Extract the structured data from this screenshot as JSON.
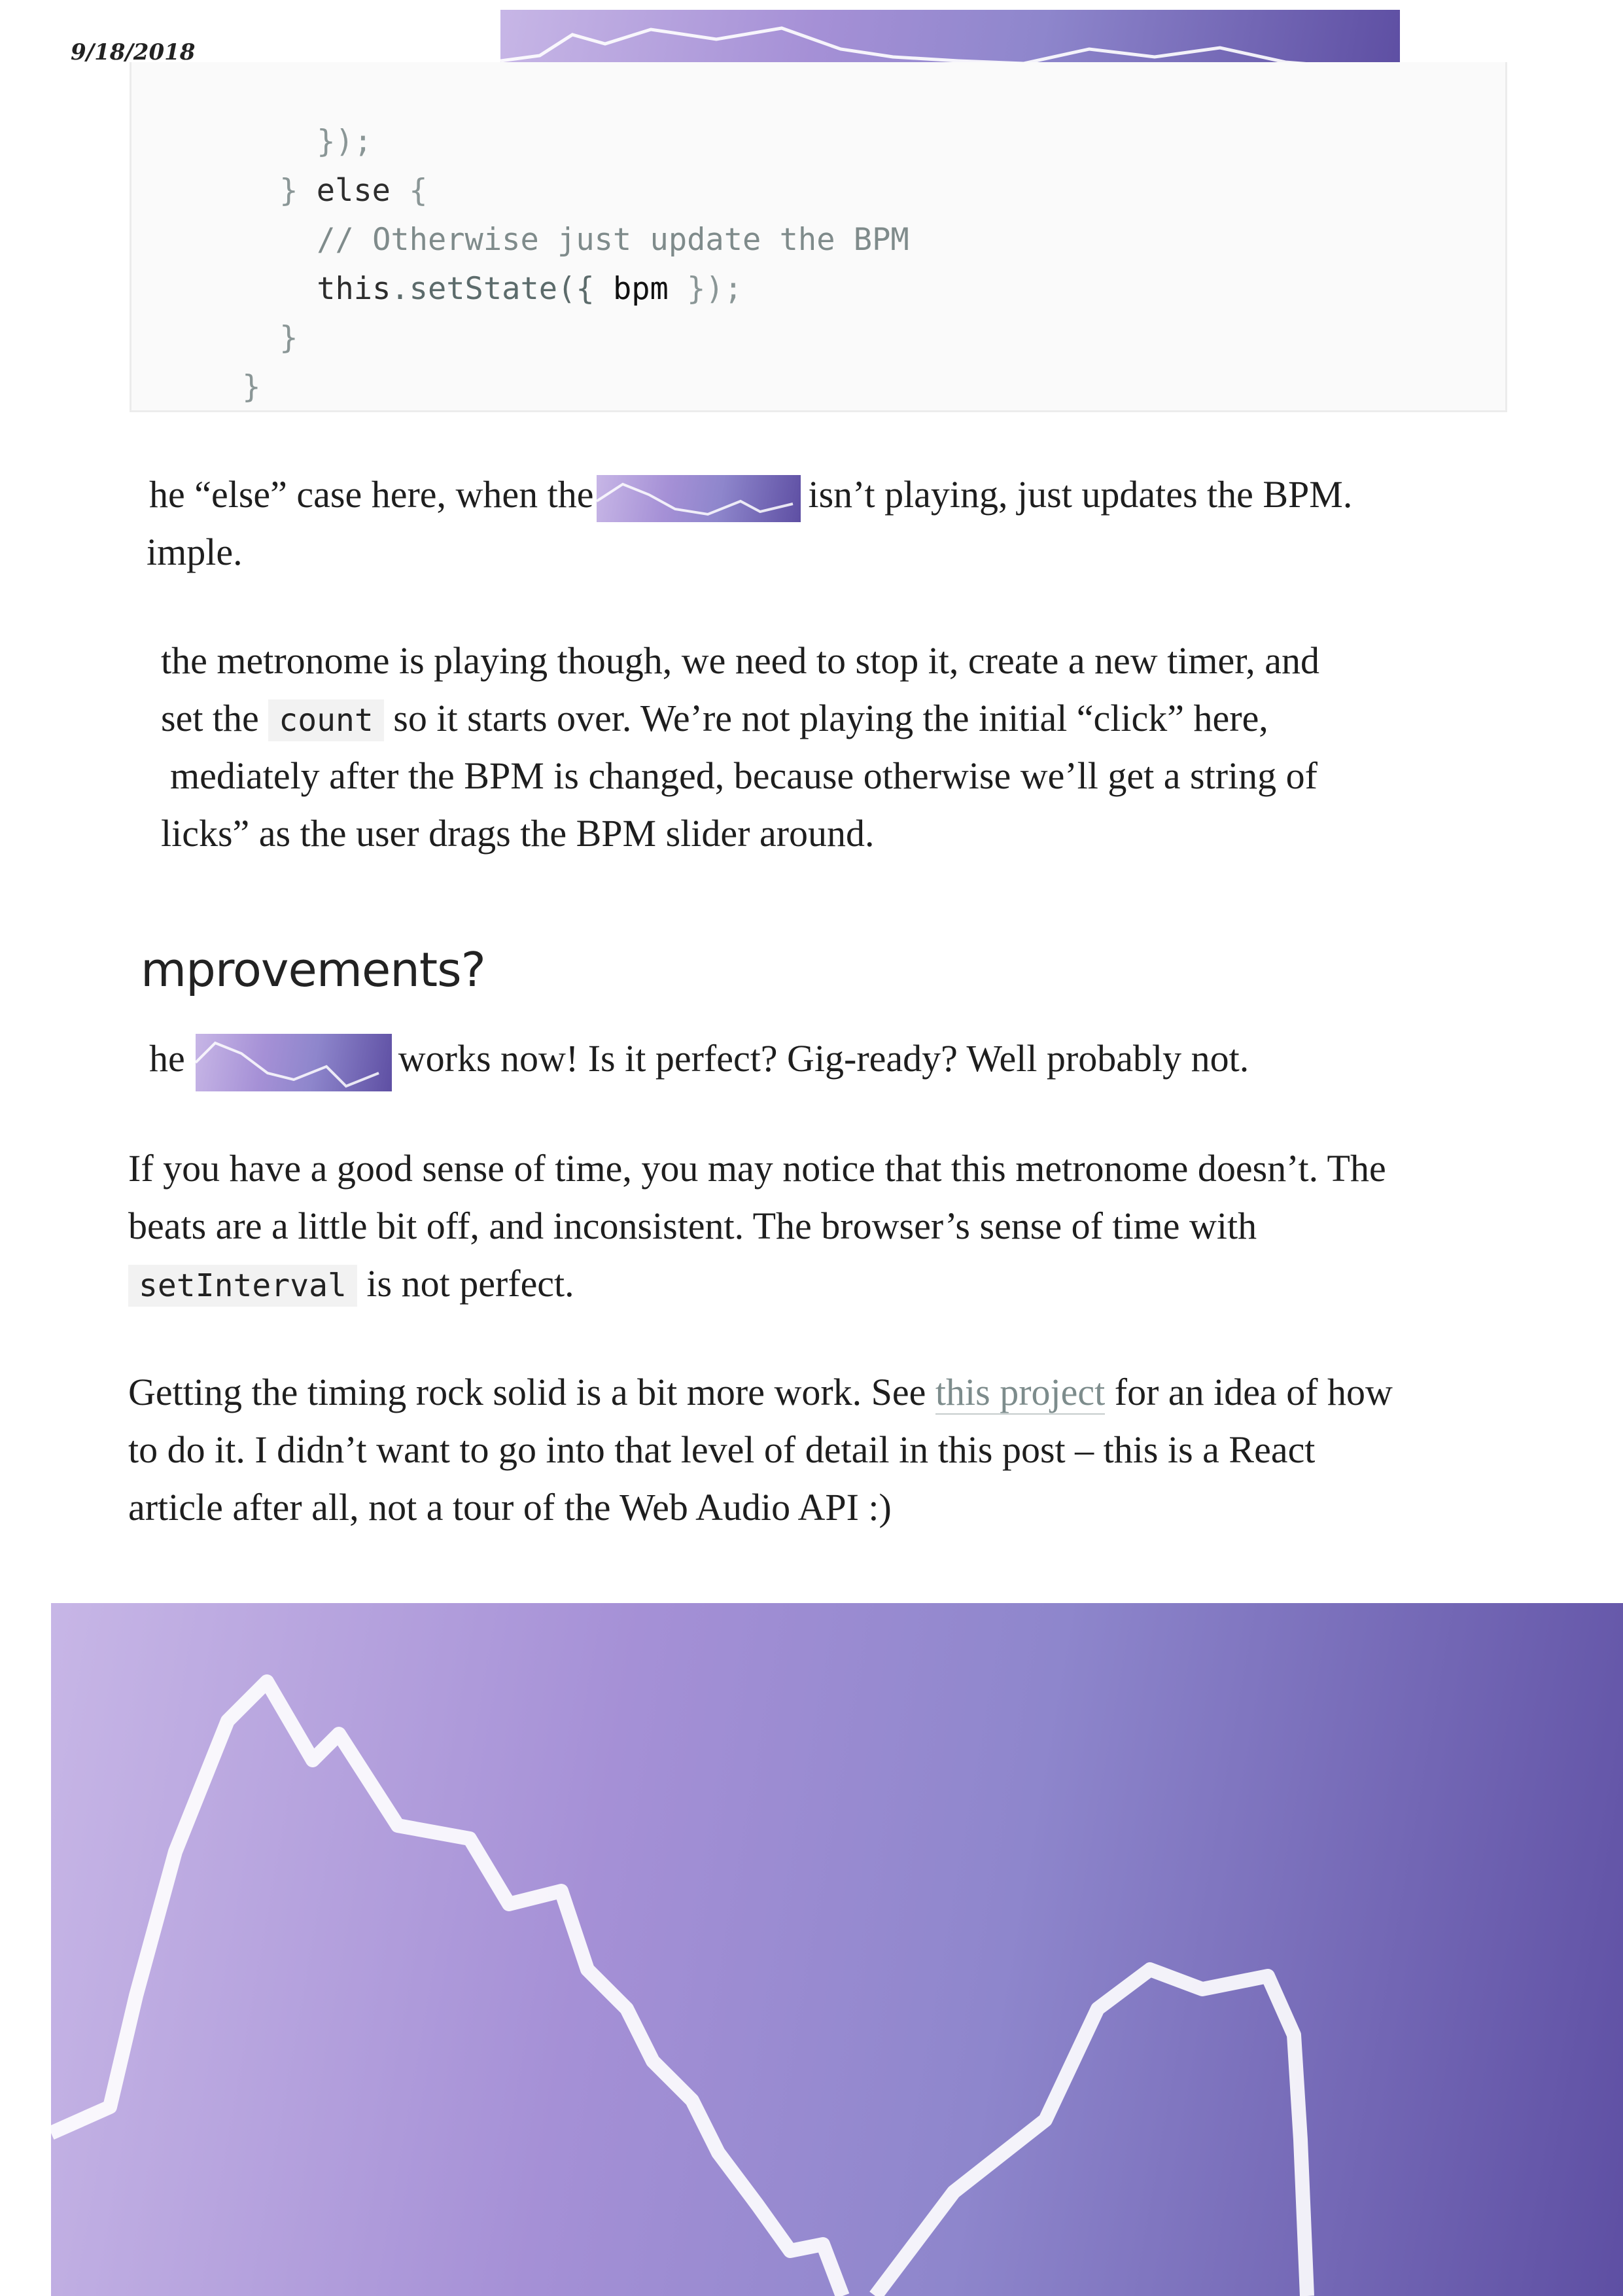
{
  "header": {
    "date": "9/18/2018"
  },
  "code": {
    "line1": "});",
    "line2_brace": "}",
    "line2_kw": "else",
    "line2_open": "{",
    "line3": "// Otherwise just update the BPM",
    "line4_this": "this",
    "line4_fn": ".setState({",
    "line4_var": "bpm",
    "line4_close": "});",
    "line5": "}",
    "line6": "}"
  },
  "para1": {
    "line1_a": "he “else” case here, when the",
    "line1_b": "isn’t playing, just updates the BPM.",
    "line2": "imple."
  },
  "para2": {
    "line1": "the metronome is playing though, we need to stop it, create a new timer, and",
    "line2_a": "set the",
    "line2_code": "count",
    "line2_b": "so it starts over. We’re not playing the initial “click” here,",
    "line3": "mediately after the BPM is changed, because otherwise we’ll get a string of",
    "line4": "licks” as the user drags the BPM slider around."
  },
  "heading": "mprovements?",
  "para3": {
    "a": "he",
    "b": "works now! Is it perfect? Gig-ready? Well probably not."
  },
  "para4": {
    "line1": "If you have a good sense of time, you may notice that this metronome doesn’t. The",
    "line2": "beats are a little bit off, and inconsistent. The browser’s sense of time with",
    "line3_code": "setInterval",
    "line3_b": "is not perfect."
  },
  "para5": {
    "line1_a": "Getting the timing rock solid is a bit more work. See",
    "line1_link": "this project",
    "line1_b": "for an idea of how",
    "line2": "to do it. I didn’t want to go into that level of detail in this post – this is a React",
    "line3": "article after all, not a tour of the Web Audio API :)"
  }
}
